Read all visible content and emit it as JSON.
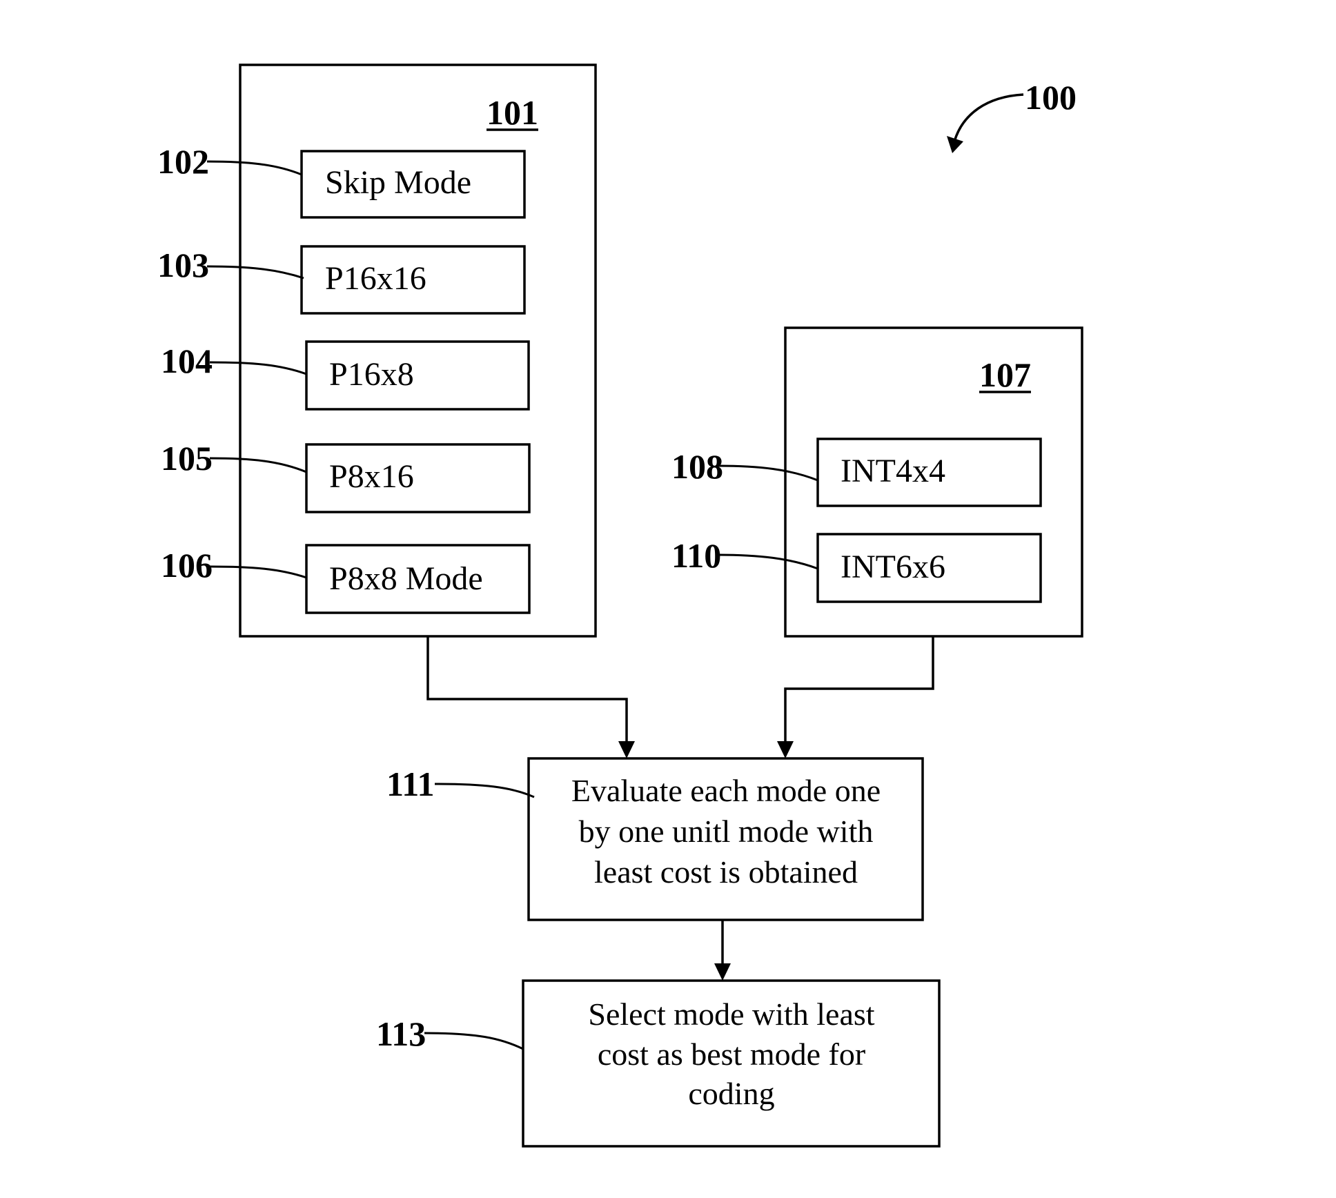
{
  "figure_ref": "100",
  "groups": [
    {
      "ref": "101",
      "modes": [
        {
          "ref": "102",
          "label": "Skip Mode"
        },
        {
          "ref": "103",
          "label": "P16x16"
        },
        {
          "ref": "104",
          "label": "P16x8"
        },
        {
          "ref": "105",
          "label": "P8x16"
        },
        {
          "ref": "106",
          "label": "P8x8 Mode"
        }
      ]
    },
    {
      "ref": "107",
      "modes": [
        {
          "ref": "108",
          "label": "INT4x4"
        },
        {
          "ref": "110",
          "label": "INT6x6"
        }
      ]
    }
  ],
  "steps": [
    {
      "ref": "111",
      "lines": [
        "Evaluate each mode one",
        "by one unitl mode with",
        "least cost is obtained"
      ]
    },
    {
      "ref": "113",
      "lines": [
        "Select mode with least",
        "cost as best mode for",
        "coding"
      ]
    }
  ]
}
